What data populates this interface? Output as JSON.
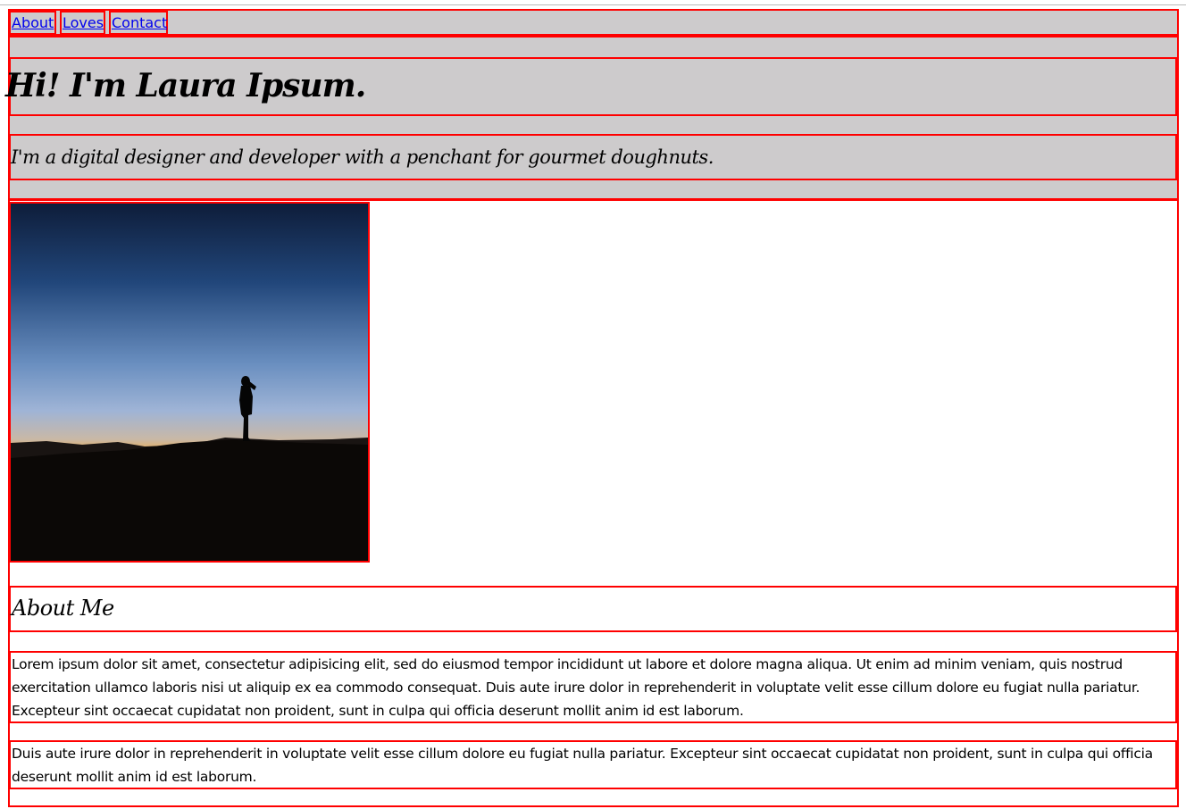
{
  "nav": {
    "links": [
      "About",
      "Loves",
      "Contact"
    ]
  },
  "header": {
    "title": "Hi! I'm Laura Ipsum.",
    "subtitle": "I'm a digital designer and developer with a penchant for gourmet doughnuts."
  },
  "main": {
    "about_heading": "About Me",
    "paragraphs": [
      "Lorem ipsum dolor sit amet, consectetur adipisicing elit, sed do eiusmod tempor incididunt ut labore et dolore magna aliqua. Ut enim ad minim veniam, quis nostrud exercitation ullamco laboris nisi ut aliquip ex ea commodo consequat. Duis aute irure dolor in reprehenderit in voluptate velit esse cillum dolore eu fugiat nulla pariatur. Excepteur sint occaecat cupidatat non proident, sunt in culpa qui officia deserunt mollit anim id est laborum.",
      "Duis aute irure dolor in reprehenderit in voluptate velit esse cillum dolore eu fugiat nulla pariatur. Excepteur sint occaecat cupidatat non proident, sunt in culpa qui officia deserunt mollit anim id est laborum."
    ]
  },
  "colors": {
    "outline": "#ff0000",
    "header_bg": "#cdcbcc",
    "link": "#0000ee"
  },
  "icons": {
    "hero_image": "silhouette-sunset-photo"
  }
}
